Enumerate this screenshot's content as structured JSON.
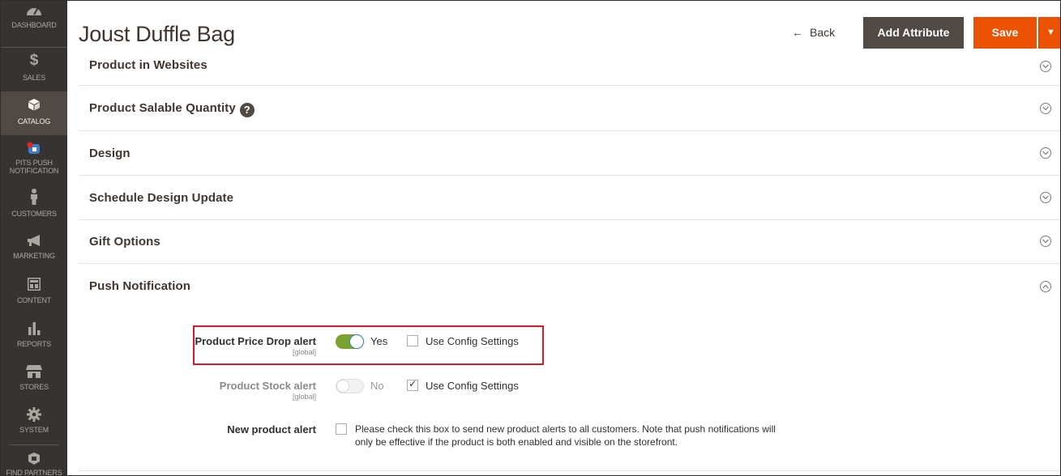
{
  "sidebar": {
    "items": [
      {
        "label": "DASHBOARD",
        "icon": "dashboard-icon"
      },
      {
        "label": "SALES",
        "icon": "dollar-icon"
      },
      {
        "label": "CATALOG",
        "icon": "cube-icon"
      },
      {
        "label": "PITS PUSH NOTIFICATION",
        "icon": "push-notification-icon"
      },
      {
        "label": "CUSTOMERS",
        "icon": "person-icon"
      },
      {
        "label": "MARKETING",
        "icon": "megaphone-icon"
      },
      {
        "label": "CONTENT",
        "icon": "layout-icon"
      },
      {
        "label": "REPORTS",
        "icon": "bar-chart-icon"
      },
      {
        "label": "STORES",
        "icon": "store-icon"
      },
      {
        "label": "SYSTEM",
        "icon": "gear-icon"
      },
      {
        "label": "FIND PARTNERS",
        "icon": "partners-icon"
      }
    ],
    "sales_symbol": "$",
    "active_item": "CATALOG",
    "colors": {
      "bg": "#373330",
      "active": "#514943"
    }
  },
  "header": {
    "title": "Joust Duffle Bag",
    "back_arrow": "←",
    "back_label": "Back",
    "add_attribute_label": "Add Attribute",
    "save_label": "Save",
    "save_split_arrow": "▼",
    "colors": {
      "save": "#eb5202",
      "add_attribute": "#514943"
    }
  },
  "sections": [
    {
      "title": "Product in Websites",
      "expanded": false
    },
    {
      "title": "Product Salable Quantity",
      "expanded": false,
      "help_icon": "?"
    },
    {
      "title": "Design",
      "expanded": false
    },
    {
      "title": "Schedule Design Update",
      "expanded": false
    },
    {
      "title": "Gift Options",
      "expanded": false
    },
    {
      "title": "Push Notification",
      "expanded": true
    }
  ],
  "push_notification": {
    "price_drop": {
      "label": "Product Price Drop alert",
      "scope": "[global]",
      "toggle_value": "Yes",
      "toggle_on": true,
      "use_config_label": "Use Config Settings",
      "use_config_checked": false
    },
    "stock": {
      "label": "Product Stock alert",
      "scope": "[global]",
      "toggle_value": "No",
      "toggle_on": false,
      "use_config_label": "Use Config Settings",
      "use_config_checked": true,
      "check_mark": "✓"
    },
    "new_product": {
      "label": "New product alert",
      "checked": false,
      "note_line1": "Please check this box to send new product alerts to all customers. Note that push notifications will",
      "note_line2": "only be effective if the product is both enabled and visible on the storefront."
    },
    "highlight_color": "#d7192a",
    "toggle_on_color": "#79a22e"
  }
}
